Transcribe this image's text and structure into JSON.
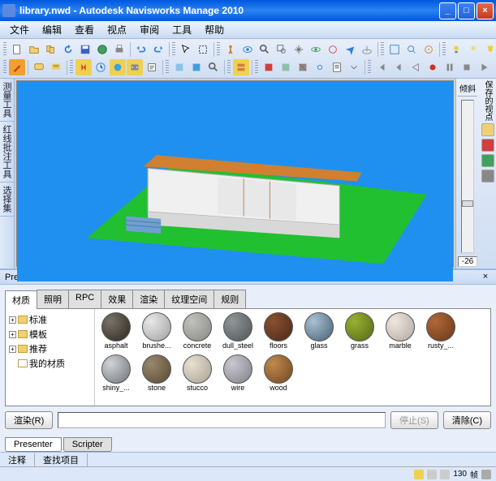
{
  "window": {
    "title": "library.nwd - Autodesk Navisworks Manage 2010"
  },
  "menu": [
    "文件",
    "编辑",
    "查看",
    "视点",
    "审阅",
    "工具",
    "帮助"
  ],
  "left_tabs": [
    "测量工具",
    "红线批注工具",
    "选择集"
  ],
  "tilt": {
    "label": "倾斜",
    "value": "-26"
  },
  "saved_views": {
    "label": "保存的视点"
  },
  "presenter": {
    "title": "Presenter",
    "tabs": [
      "材质",
      "照明",
      "RPC",
      "效果",
      "渲染",
      "纹理空间",
      "规则"
    ],
    "tree": [
      "标准",
      "模板",
      "推荐",
      "我的材质"
    ],
    "materials": [
      {
        "name": "asphalt",
        "bg": "radial-gradient(circle at 30% 30%, #7a7268, #2a2620)"
      },
      {
        "name": "brushe...",
        "bg": "radial-gradient(circle at 30% 30%, #e8e8e8, #a0a0a0)"
      },
      {
        "name": "concrete",
        "bg": "radial-gradient(circle at 30% 30%, #c0c0bc, #888884)"
      },
      {
        "name": "dull_steel",
        "bg": "radial-gradient(circle at 30% 30%, #909698, #505658)"
      },
      {
        "name": "floors",
        "bg": "radial-gradient(circle at 30% 30%, #8a5030, #4a2818)"
      },
      {
        "name": "glass",
        "bg": "radial-gradient(circle at 30% 30%, #a8c0d0, #486078)"
      },
      {
        "name": "grass",
        "bg": "radial-gradient(circle at 30% 30%, #98b030, #586818)"
      },
      {
        "name": "marble",
        "bg": "radial-gradient(circle at 30% 30%, #f0e8e0, #b0a8a0)"
      },
      {
        "name": "rusty_...",
        "bg": "radial-gradient(circle at 30% 30%, #b06838, #683818)"
      },
      {
        "name": "shiny_...",
        "bg": "radial-gradient(circle at 30% 30%, #d0d4d8, #707478)"
      },
      {
        "name": "stone",
        "bg": "radial-gradient(circle at 30% 30%, #988870, #584830)"
      },
      {
        "name": "stucco",
        "bg": "radial-gradient(circle at 30% 30%, #e8e0d0, #a8a090)"
      },
      {
        "name": "wire",
        "bg": "radial-gradient(circle at 30% 30%, #c8c8d0, #808088)"
      },
      {
        "name": "wood",
        "bg": "radial-gradient(circle at 30% 30%, #c08850, #704820)"
      }
    ],
    "render_btn": "渲染(R)",
    "stop_btn": "停止(S)",
    "clear_btn": "清除(C)",
    "bottom_tabs": [
      "Presenter",
      "Scripter"
    ]
  },
  "status_tabs": [
    "注释",
    "查找项目"
  ],
  "status": {
    "fps": "130",
    "unit": "帧"
  }
}
